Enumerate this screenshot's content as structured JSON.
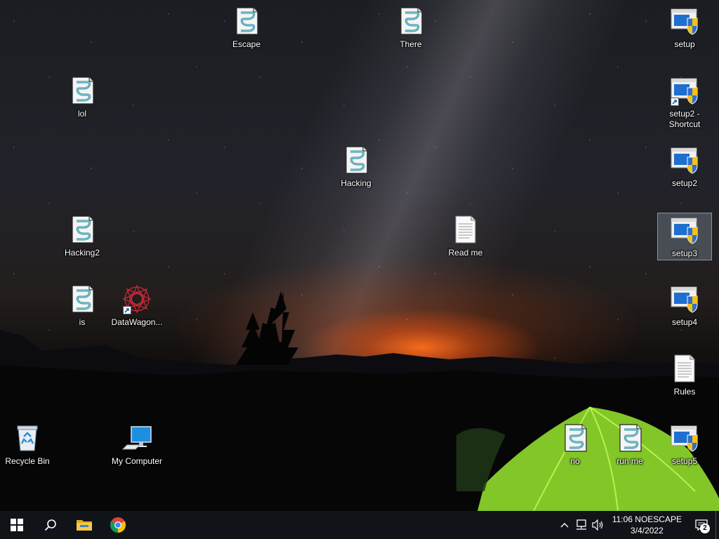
{
  "desktop": {
    "icons": {
      "escape": {
        "label": "Escape",
        "icon": "script-icon"
      },
      "there": {
        "label": "There",
        "icon": "script-icon"
      },
      "setup": {
        "label": "setup",
        "icon": "installer-icon"
      },
      "lol": {
        "label": "lol",
        "icon": "script-icon"
      },
      "setup2_shortcut": {
        "label": "setup2 -\nShortcut",
        "icon": "installer-shortcut-icon"
      },
      "hacking": {
        "label": "Hacking",
        "icon": "script-icon"
      },
      "setup2": {
        "label": "setup2",
        "icon": "installer-icon"
      },
      "hacking2": {
        "label": "Hacking2",
        "icon": "script-icon"
      },
      "read_me": {
        "label": "Read me",
        "icon": "text-document-icon"
      },
      "setup3": {
        "label": "setup3",
        "icon": "installer-icon",
        "selected": true
      },
      "is": {
        "label": "is",
        "icon": "script-icon"
      },
      "datawagon": {
        "label": "DataWagon...",
        "icon": "datawagon-shortcut-icon"
      },
      "setup4": {
        "label": "setup4",
        "icon": "installer-icon"
      },
      "rules": {
        "label": "Rules",
        "icon": "text-document-icon"
      },
      "recycle_bin": {
        "label": "Recycle Bin",
        "icon": "recycle-bin-icon"
      },
      "my_computer": {
        "label": "My Computer",
        "icon": "computer-icon"
      },
      "no": {
        "label": "no",
        "icon": "script-icon"
      },
      "run_me": {
        "label": "run me",
        "icon": "script-icon"
      },
      "setup5": {
        "label": "setup5",
        "icon": "installer-icon"
      }
    }
  },
  "taskbar": {
    "start": {
      "icon": "windows-logo-icon"
    },
    "search": {
      "icon": "search-icon"
    },
    "pinned": [
      {
        "name": "File Explorer",
        "icon": "folder-icon"
      },
      {
        "name": "Google Chrome",
        "icon": "chrome-icon"
      }
    ],
    "tray": {
      "icons": [
        "chevron-up-icon",
        "network-icon",
        "volume-icon"
      ],
      "time": "11:06 NOESCAPE",
      "date": "3/4/2022",
      "notification_count": "2"
    }
  },
  "colors": {
    "taskbar_bg": "#101318",
    "selection": "#a0b4c8",
    "tent_green": "#8ad12a",
    "sunset_orange": "#ff6e1e"
  }
}
